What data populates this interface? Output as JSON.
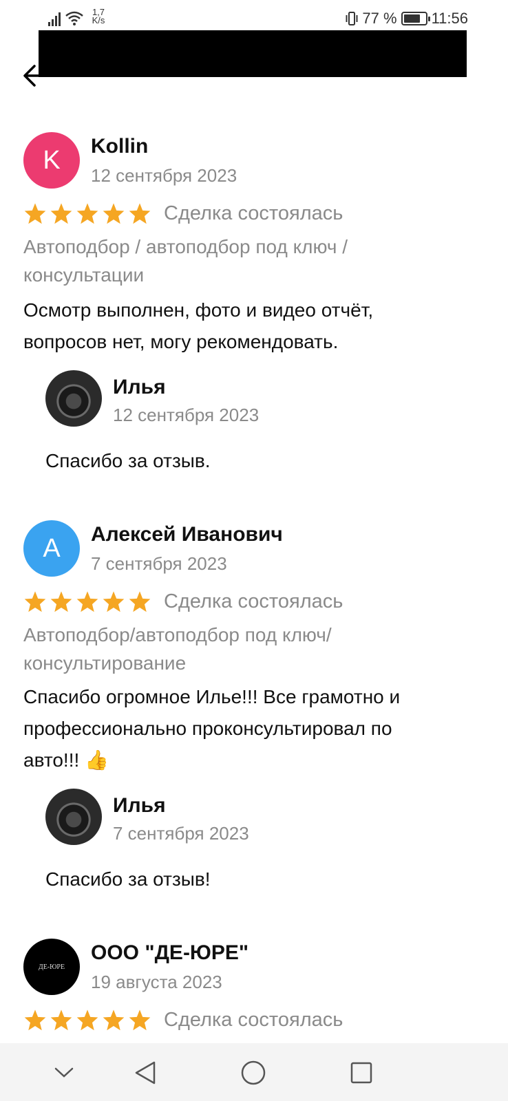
{
  "status_bar": {
    "speed_value": "1,7",
    "speed_unit": "K/s",
    "battery_percent": "77 %",
    "battery_level": 0.77,
    "time": "11:56"
  },
  "header": {
    "back_icon": "arrow-left-icon"
  },
  "reviews": [
    {
      "avatar_letter": "K",
      "avatar_color": "#ec3b70",
      "author": "Kollin",
      "date": "12 сентября 2023",
      "rating": 5,
      "deal_status": "Сделка состоялась",
      "category_lines": [
        "Автоподбор / автоподбор под ключ /",
        "консультации"
      ],
      "text_lines": [
        "Осмотр выполнен, фото и видео отчёт,",
        "вопросов нет, могу рекомендовать."
      ],
      "reply": {
        "author": "Илья",
        "date": "12 сентября 2023",
        "text": "Спасибо за отзыв."
      }
    },
    {
      "avatar_letter": "А",
      "avatar_color": "#3aa3f0",
      "author": "Алексей Иванович",
      "date": "7 сентября 2023",
      "rating": 5,
      "deal_status": "Сделка состоялась",
      "category_lines": [
        "Автоподбор/автоподбор под ключ/",
        "консультирование"
      ],
      "text_lines": [
        "Спасибо огромное Илье!!! Все грамотно и",
        "профессионально проконсультировал по",
        "авто!!! 👍"
      ],
      "reply": {
        "author": "Илья",
        "date": "7 сентября 2023",
        "text": "Спасибо за отзыв!"
      }
    },
    {
      "avatar_logo_text": "ДЕ-ЮРЕ",
      "avatar_color": "#000000",
      "author": "ООО \"ДЕ-ЮРЕ\"",
      "date": "19 августа 2023",
      "rating": 5,
      "deal_status": "Сделка состоялась"
    }
  ],
  "colors": {
    "star": "#f5a623",
    "muted_text": "#8a8a8a"
  },
  "nav_bar": {
    "icons": [
      "chevron-down-icon",
      "back-triangle-icon",
      "home-circle-icon",
      "recents-square-icon"
    ]
  }
}
